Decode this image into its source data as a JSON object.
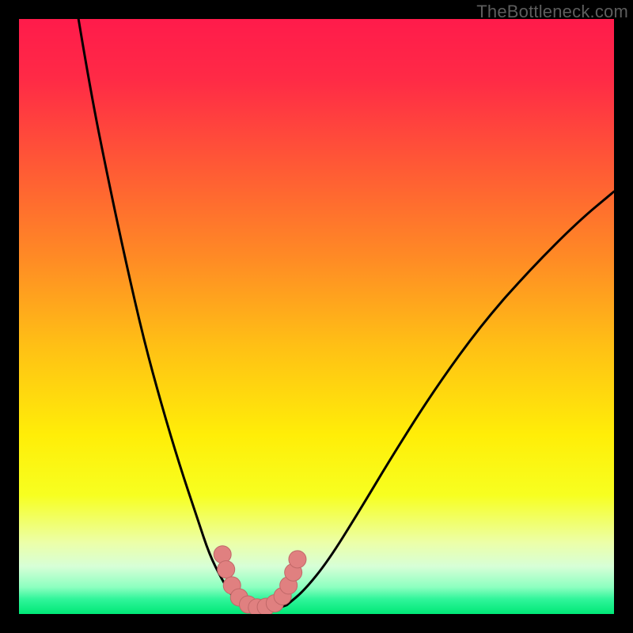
{
  "watermark": "TheBottleneck.com",
  "colors": {
    "frame": "#000000",
    "gradient_stops": [
      {
        "offset": 0.0,
        "color": "#ff1b4b"
      },
      {
        "offset": 0.1,
        "color": "#ff2a46"
      },
      {
        "offset": 0.25,
        "color": "#ff5a35"
      },
      {
        "offset": 0.4,
        "color": "#ff8a25"
      },
      {
        "offset": 0.55,
        "color": "#ffc015"
      },
      {
        "offset": 0.7,
        "color": "#ffee08"
      },
      {
        "offset": 0.8,
        "color": "#f7ff20"
      },
      {
        "offset": 0.88,
        "color": "#ecffa8"
      },
      {
        "offset": 0.92,
        "color": "#d7ffd7"
      },
      {
        "offset": 0.955,
        "color": "#8cffc0"
      },
      {
        "offset": 0.975,
        "color": "#30f59a"
      },
      {
        "offset": 1.0,
        "color": "#00e877"
      }
    ],
    "curve": "#000000",
    "marker_fill": "#e08080",
    "marker_stroke": "#c06868"
  },
  "chart_data": {
    "type": "line",
    "title": "",
    "xlabel": "",
    "ylabel": "",
    "xlim": [
      0,
      100
    ],
    "ylim": [
      0,
      100
    ],
    "grid": false,
    "series": [
      {
        "name": "left-curve",
        "x": [
          10,
          12,
          15,
          18,
          21,
          24,
          27,
          30,
          32,
          34,
          35.5,
          37
        ],
        "y": [
          100,
          88,
          73,
          59,
          46,
          35,
          25,
          16,
          10,
          6,
          3.5,
          1.5
        ]
      },
      {
        "name": "valley-floor",
        "x": [
          37,
          39,
          41,
          43,
          45
        ],
        "y": [
          1.5,
          0.8,
          0.6,
          0.8,
          1.5
        ]
      },
      {
        "name": "right-curve",
        "x": [
          45,
          48,
          52,
          57,
          63,
          70,
          78,
          86,
          94,
          100
        ],
        "y": [
          1.5,
          4,
          9,
          17,
          27,
          38,
          49,
          58,
          66,
          71
        ]
      }
    ],
    "markers": {
      "name": "highlight-segment",
      "x": [
        34.2,
        34.8,
        35.8,
        37.0,
        38.5,
        40.0,
        41.5,
        43.0,
        44.3,
        45.3,
        46.1,
        46.8
      ],
      "y": [
        10.0,
        7.5,
        4.8,
        2.8,
        1.6,
        1.1,
        1.2,
        1.8,
        3.0,
        4.8,
        7.0,
        9.2
      ]
    }
  }
}
